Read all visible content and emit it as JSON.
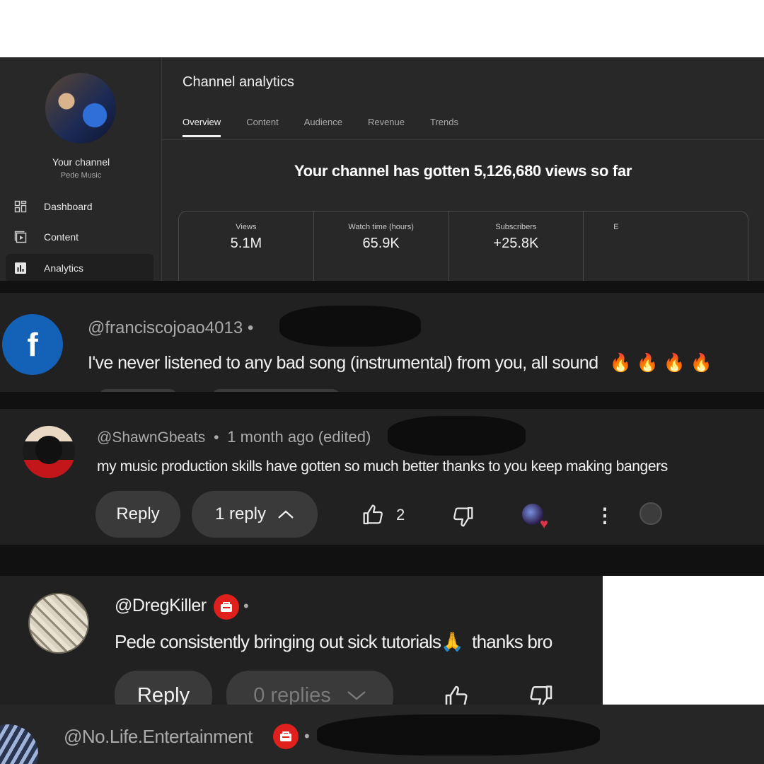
{
  "studio": {
    "sidebar": {
      "your_channel": "Your channel",
      "channel_name": "Pede Music",
      "items": [
        {
          "label": "Dashboard",
          "icon": "dashboard-icon"
        },
        {
          "label": "Content",
          "icon": "content-icon"
        },
        {
          "label": "Analytics",
          "icon": "analytics-icon",
          "active": true
        }
      ]
    },
    "title": "Channel analytics",
    "tabs": [
      {
        "label": "Overview",
        "active": true
      },
      {
        "label": "Content"
      },
      {
        "label": "Audience"
      },
      {
        "label": "Revenue"
      },
      {
        "label": "Trends"
      }
    ],
    "headline": "Your channel has gotten 5,126,680 views so far",
    "metrics": [
      {
        "label": "Views",
        "value": "5.1M"
      },
      {
        "label": "Watch time (hours)",
        "value": "65.9K"
      },
      {
        "label": "Subscribers",
        "value": "+25.8K"
      },
      {
        "label": "E",
        "value": ""
      }
    ]
  },
  "comments": [
    {
      "handle": "@franciscojoao4013",
      "separator": "•",
      "text": "I've never listened to any bad song (instrumental) from you, all sound",
      "emoji": "🔥 🔥 🔥 🔥",
      "avatar_letter": "f",
      "avatar_color": "#1461b8"
    },
    {
      "handle": "@ShawnGbeats",
      "separator": "•",
      "time": "1 month ago (edited)",
      "text": "my music production skills have gotten so much better thanks to you keep making bangers",
      "reply_label": "Reply",
      "replies_label": "1 reply",
      "like_count": "2"
    },
    {
      "handle": "@DregKiller",
      "separator": "•",
      "text": "Pede consistently bringing out sick tutorials",
      "emoji": "🙏",
      "text_after": "thanks bro",
      "reply_label": "Reply",
      "replies_label": "0 replies"
    },
    {
      "handle": "@No.Life.Entertainment",
      "separator": "•"
    }
  ],
  "colors": {
    "studio_bg": "#282828",
    "strip_bg": "#212121",
    "pill_bg": "#3a3a3a",
    "badge_red": "#e0201c",
    "heart_red": "#e0334a"
  }
}
